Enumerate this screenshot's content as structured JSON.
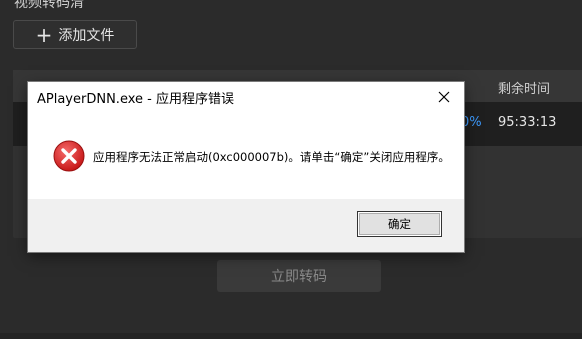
{
  "app": {
    "title": "视频转码清",
    "add_file_label": "添加文件",
    "convert_label": "立即转码"
  },
  "table": {
    "header_remaining": "剩余时间",
    "row": {
      "progress": "0%",
      "remaining": "95:33:13"
    }
  },
  "dialog": {
    "title": "APlayerDNN.exe - 应用程序错误",
    "message": "应用程序无法正常启动(0xc000007b)。请单击“确定”关闭应用程序。",
    "ok_label": "确定",
    "icon": "error-icon"
  },
  "colors": {
    "accent": "#3d9bff",
    "error": "#d81e1e"
  }
}
